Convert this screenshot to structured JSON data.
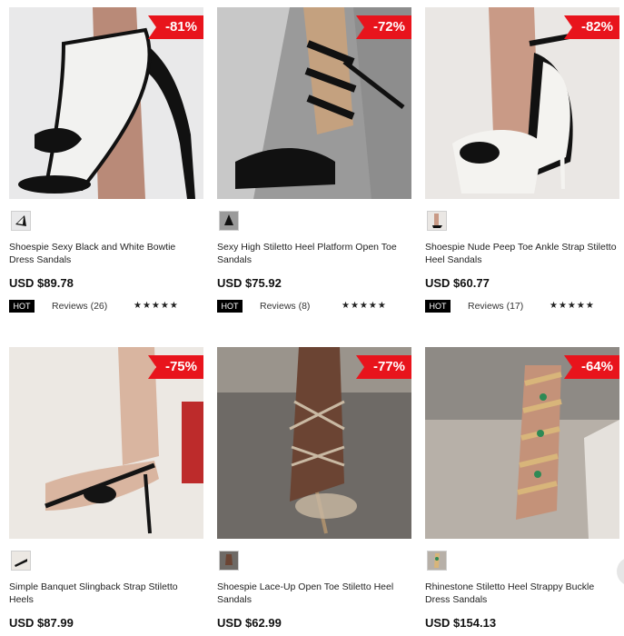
{
  "products": [
    {
      "discount": "-81%",
      "name": "Shoespie Sexy Black and White Bowtie Dress Sandals",
      "price": "USD $89.78",
      "hot": "HOT",
      "reviews": "Reviews (26)",
      "rating": "★★★★★",
      "colors": {
        "bg": "#e9e9ea",
        "shoe": "#111111",
        "accent": "#f2f2f0",
        "skin": "#b98a78"
      }
    },
    {
      "discount": "-72%",
      "name": "Sexy High Stiletto Heel Platform Open Toe Sandals",
      "price": "USD $75.92",
      "hot": "HOT",
      "reviews": "Reviews (8)",
      "rating": "★★★★★",
      "colors": {
        "bg": "#9a9a9a",
        "shoe": "#111111",
        "accent": "#6c6c6c",
        "skin": "#c4a17f"
      }
    },
    {
      "discount": "-82%",
      "name": "Shoespie Nude Peep Toe Ankle Strap Stiletto Heel Sandals",
      "price": "USD $60.77",
      "hot": "HOT",
      "reviews": "Reviews (17)",
      "rating": "★★★★★",
      "colors": {
        "bg": "#eae7e4",
        "shoe": "#f4f3f0",
        "accent": "#111111",
        "skin": "#c99a86"
      }
    },
    {
      "discount": "-75%",
      "name": "Simple Banquet Slingback Strap Stiletto Heels",
      "price": "USD $87.99",
      "hot": "",
      "reviews": "",
      "rating": "",
      "colors": {
        "bg": "#ece8e3",
        "shoe": "#141414",
        "accent": "#bd2b2b",
        "skin": "#d9b5a0"
      }
    },
    {
      "discount": "-77%",
      "name": "Shoespie Lace-Up Open Toe Stiletto Heel Sandals",
      "price": "USD $62.99",
      "hot": "",
      "reviews": "",
      "rating": "",
      "colors": {
        "bg": "#6e6a66",
        "shoe": "#c9b9a3",
        "accent": "#a98e6d",
        "skin": "#6b4433"
      }
    },
    {
      "discount": "-64%",
      "name": "Rhinestone Stiletto Heel Strappy Buckle Dress Sandals",
      "price": "USD $154.13",
      "hot": "",
      "reviews": "",
      "rating": "",
      "colors": {
        "bg": "#b7b0a8",
        "shoe": "#2e8a55",
        "accent": "#d8b57a",
        "skin": "#c49279"
      }
    }
  ]
}
